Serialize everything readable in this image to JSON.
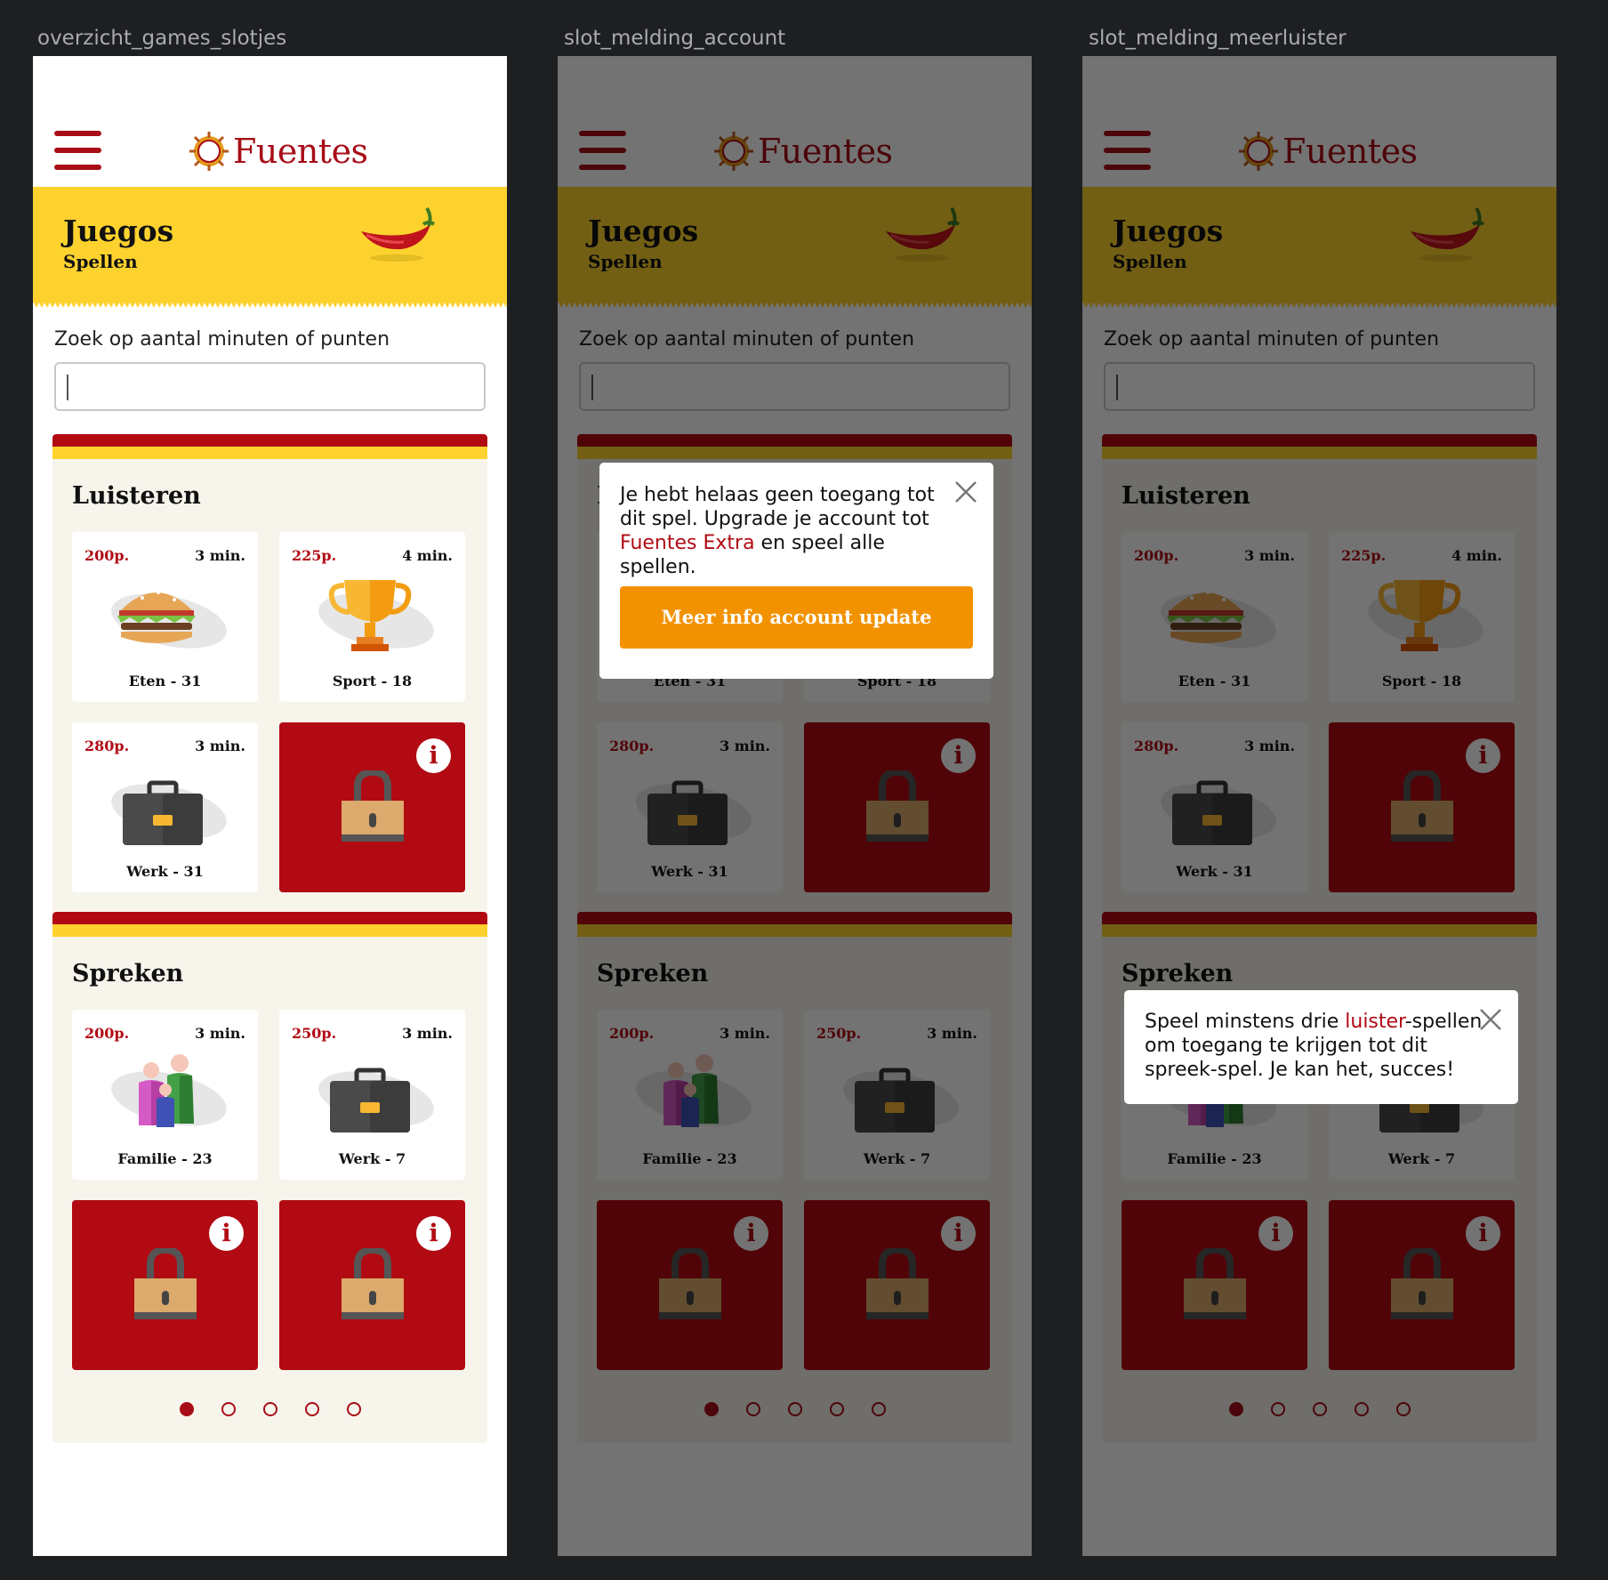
{
  "frames": [
    {
      "label": "overzicht_games_slotjes"
    },
    {
      "label": "slot_melding_account"
    },
    {
      "label": "slot_melding_meerluister"
    }
  ],
  "brand": {
    "name": "Fuentes",
    "color": "#a80d17",
    "yellow": "#fdd22e"
  },
  "header": {
    "title": "Juegos",
    "subtitle": "Spellen"
  },
  "search": {
    "label": "Zoek op aantal minuten of punten",
    "value": ""
  },
  "sections": [
    {
      "title": "Luisteren",
      "cards": [
        {
          "points": "200p.",
          "minutes": "3 min.",
          "name": "Eten - 31",
          "icon": "burger-icon"
        },
        {
          "points": "225p.",
          "minutes": "4 min.",
          "name": "Sport - 18",
          "icon": "trophy-icon"
        },
        {
          "points": "280p.",
          "minutes": "3 min.",
          "name": "Werk - 31",
          "icon": "briefcase-icon"
        },
        {
          "locked": true,
          "info": "i",
          "icon": "lock-icon"
        }
      ],
      "pages": 5,
      "active_page": 1
    },
    {
      "title": "Spreken",
      "cards": [
        {
          "points": "200p.",
          "minutes": "3 min.",
          "name": "Familie - 23",
          "icon": "family-icon"
        },
        {
          "points": "250p.",
          "minutes": "3 min.",
          "name": "Werk - 7",
          "icon": "briefcase-icon"
        },
        {
          "locked": true,
          "info": "i",
          "icon": "lock-icon"
        },
        {
          "locked": true,
          "info": "i",
          "icon": "lock-icon"
        }
      ],
      "pages": 5,
      "active_page": 1
    }
  ],
  "popup_account": {
    "text_1": "Je hebt helaas geen toegang tot",
    "text_2": "dit spel. Upgrade je account tot",
    "text_3_highlight": "Fuentes Extra",
    "text_3_rest": " en speel alle spellen.",
    "button": "Meer info account update"
  },
  "popup_listen": {
    "text_1_pre": "Speel minstens drie ",
    "text_1_highlight": "luister",
    "text_1_post": "-spellen",
    "text_2": "om toegang te krijgen tot dit",
    "text_3": "spreek-spel. Je kan het, succes!"
  }
}
